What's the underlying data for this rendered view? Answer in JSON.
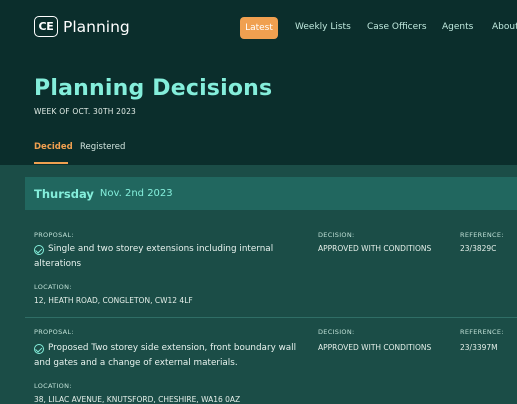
{
  "header": {
    "logo_mark": "CE",
    "logo_text": "Planning",
    "nav": {
      "latest": "Latest",
      "weekly_lists": "Weekly Lists",
      "case_officers": "Case Officers",
      "agents": "Agents",
      "about": "About"
    }
  },
  "page": {
    "title": "Planning Decisions",
    "subtitle": "WEEK OF OCT. 30TH 2023"
  },
  "tabs": {
    "decided": "Decided",
    "registered": "Registered"
  },
  "day": {
    "name": "Thursday",
    "date": "Nov. 2nd 2023"
  },
  "labels": {
    "proposal": "PROPOSAL:",
    "decision": "DECISION:",
    "reference": "REFERENCE:",
    "location": "LOCATION:"
  },
  "colors": {
    "accent": "#f0a050",
    "title": "#84eedb",
    "header_bg": "#0b2e2c",
    "list_bg": "#1b4d47"
  },
  "decisions": [
    {
      "icon": "check-circle-icon",
      "proposal": "Single and two storey extensions including internal alterations",
      "decision": "APPROVED WITH CONDITIONS",
      "reference": "23/3829C",
      "location": "12, HEATH ROAD, CONGLETON, CW12 4LF"
    },
    {
      "icon": "check-circle-icon",
      "proposal": "Proposed Two storey side extension, front boundary wall and gates and a change of external materials.",
      "decision": "APPROVED WITH CONDITIONS",
      "reference": "23/3397M",
      "location": "38, LILAC AVENUE, KNUTSFORD, CHESHIRE, WA16 0AZ"
    }
  ]
}
